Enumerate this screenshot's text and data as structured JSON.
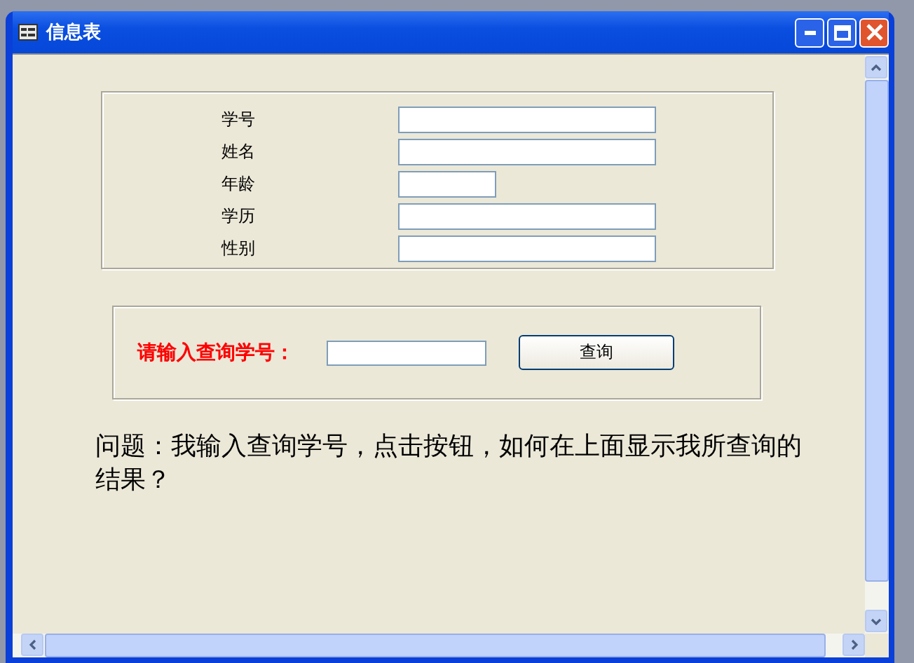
{
  "window": {
    "title": "信息表"
  },
  "form": {
    "fields": [
      {
        "label": "学号",
        "kind": "wide"
      },
      {
        "label": "姓名",
        "kind": "wide"
      },
      {
        "label": "年龄",
        "kind": "short"
      },
      {
        "label": "学历",
        "kind": "wide"
      },
      {
        "label": "性别",
        "kind": "wide"
      }
    ]
  },
  "query": {
    "label": "请输入查询学号：",
    "button": "查询"
  },
  "question": "问题：我输入查询学号，点击按钮，如何在上面显示我所查询的结果？"
}
